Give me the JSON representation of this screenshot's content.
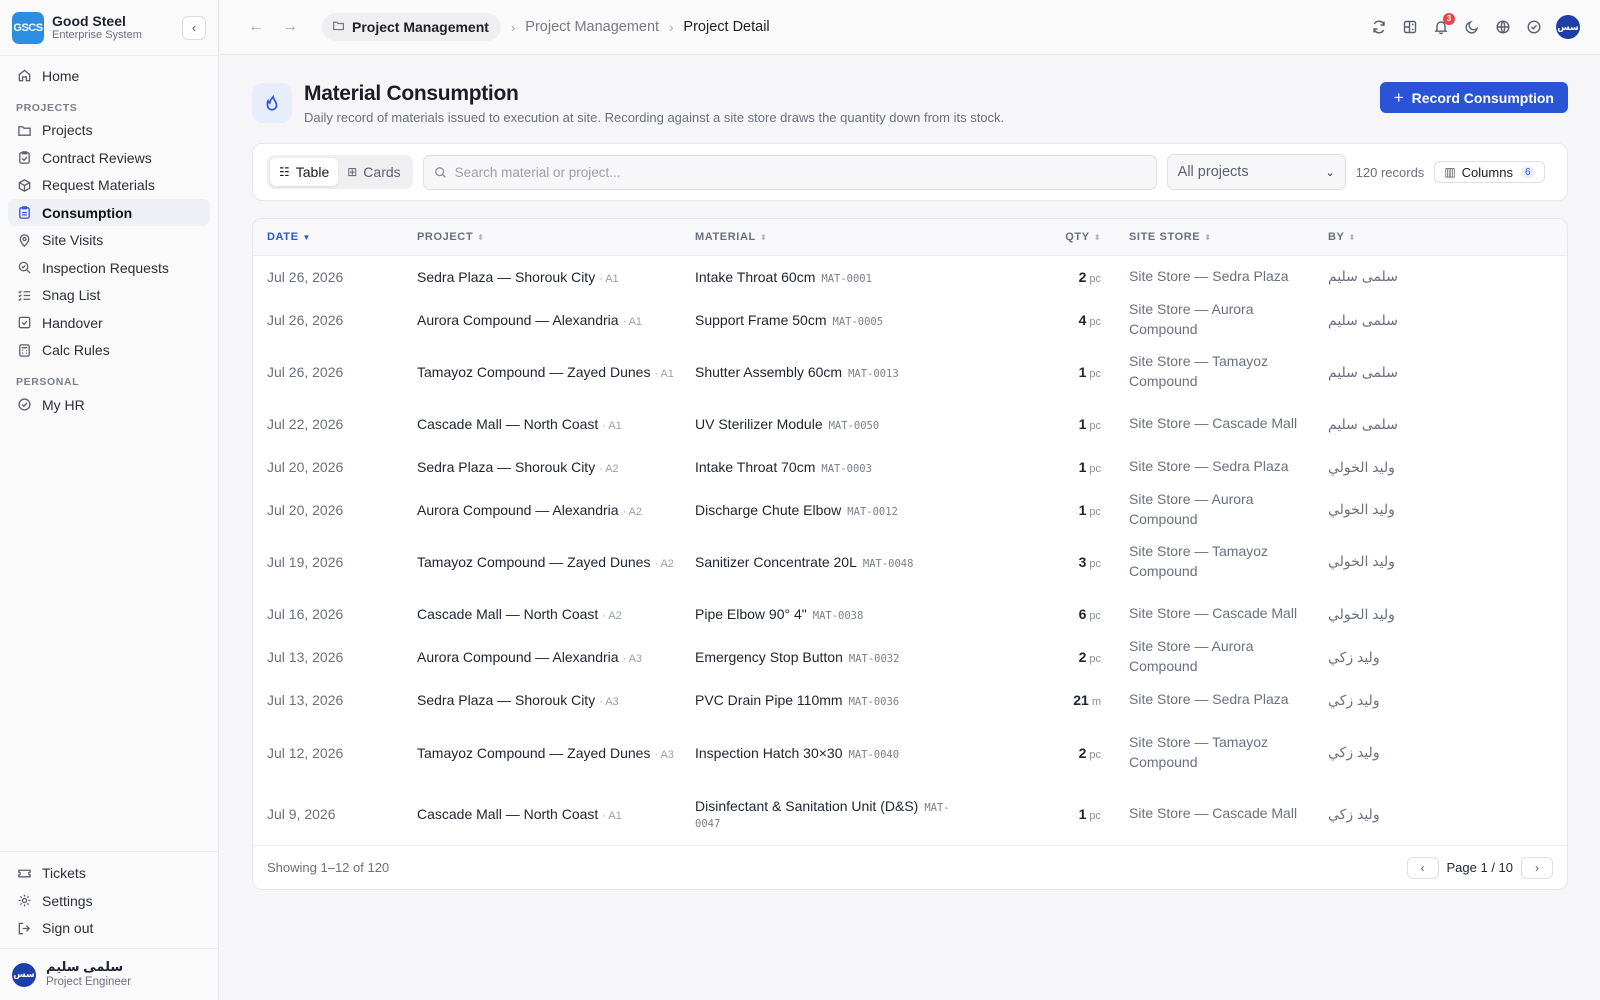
{
  "brand": {
    "logo": "GSCS",
    "name": "Good Steel",
    "subtitle": "Enterprise System"
  },
  "nav": {
    "home": "Home",
    "projects_section": "PROJECTS",
    "projects_items": [
      {
        "label": "Projects",
        "icon": "folder-icon"
      },
      {
        "label": "Contract Reviews",
        "icon": "clipboard-check-icon"
      },
      {
        "label": "Request Materials",
        "icon": "boxes-icon"
      },
      {
        "label": "Consumption",
        "icon": "clipboard-icon"
      },
      {
        "label": "Site Visits",
        "icon": "map-pin-icon"
      },
      {
        "label": "Inspection Requests",
        "icon": "search-check-icon"
      },
      {
        "label": "Snag List",
        "icon": "list-check-icon"
      },
      {
        "label": "Handover",
        "icon": "square-check-icon"
      },
      {
        "label": "Calc Rules",
        "icon": "calculator-icon"
      }
    ],
    "personal_section": "PERSONAL",
    "my_hr": "My HR",
    "bottom": {
      "tickets": "Tickets",
      "settings": "Settings",
      "sign_out": "Sign out"
    }
  },
  "user": {
    "name": "سلمى سليم",
    "role": "Project Engineer",
    "initials": "سس"
  },
  "topbar": {
    "chip": "Project Management",
    "crumb1": "Project Management",
    "crumb2": "Project Detail",
    "notifications_count": "3"
  },
  "page": {
    "title": "Material Consumption",
    "subtitle": "Daily record of materials issued to execution at site. Recording against a site store draws the quantity down from its stock.",
    "primary_action": "Record Consumption"
  },
  "toolbar": {
    "view_table": "Table",
    "view_cards": "Cards",
    "search_placeholder": "Search material or project...",
    "project_filter": "All projects",
    "records": "120 records",
    "columns_label": "Columns",
    "columns_count": "6"
  },
  "table": {
    "headers": {
      "date": "DATE",
      "project": "PROJECT",
      "material": "MATERIAL",
      "qty": "QTY",
      "site_store": "SITE STORE",
      "by": "BY"
    },
    "rows": [
      {
        "date": "Jul 26, 2026",
        "project": "Sedra Plaza — Shorouk City",
        "phase": "· A1",
        "material": "Intake Throat 60cm",
        "code": "MAT-0001",
        "qty": "2",
        "unit": "pc",
        "store": "Site Store — Sedra Plaza",
        "by": "سلمى سليم"
      },
      {
        "date": "Jul 26, 2026",
        "project": "Aurora Compound — Alexandria",
        "phase": "· A1",
        "material": "Support Frame 50cm",
        "code": "MAT-0005",
        "qty": "4",
        "unit": "pc",
        "store": "Site Store — Aurora Compound",
        "by": "سلمى سليم"
      },
      {
        "date": "Jul 26, 2026",
        "project": "Tamayoz Compound — Zayed Dunes",
        "phase": "· A1",
        "material": "Shutter Assembly 60cm",
        "code": "MAT-0013",
        "qty": "1",
        "unit": "pc",
        "store": "Site Store — Tamayoz Compound",
        "by": "سلمى سليم"
      },
      {
        "date": "Jul 22, 2026",
        "project": "Cascade Mall — North Coast",
        "phase": "· A1",
        "material": "UV Sterilizer Module",
        "code": "MAT-0050",
        "qty": "1",
        "unit": "pc",
        "store": "Site Store — Cascade Mall",
        "by": "سلمى سليم"
      },
      {
        "date": "Jul 20, 2026",
        "project": "Sedra Plaza — Shorouk City",
        "phase": "· A2",
        "material": "Intake Throat 70cm",
        "code": "MAT-0003",
        "qty": "1",
        "unit": "pc",
        "store": "Site Store — Sedra Plaza",
        "by": "وليد الخولي"
      },
      {
        "date": "Jul 20, 2026",
        "project": "Aurora Compound — Alexandria",
        "phase": "· A2",
        "material": "Discharge Chute Elbow",
        "code": "MAT-0012",
        "qty": "1",
        "unit": "pc",
        "store": "Site Store — Aurora Compound",
        "by": "وليد الخولي"
      },
      {
        "date": "Jul 19, 2026",
        "project": "Tamayoz Compound — Zayed Dunes",
        "phase": "· A2",
        "material": "Sanitizer Concentrate 20L",
        "code": "MAT-0048",
        "qty": "3",
        "unit": "pc",
        "store": "Site Store — Tamayoz Compound",
        "by": "وليد الخولي"
      },
      {
        "date": "Jul 16, 2026",
        "project": "Cascade Mall — North Coast",
        "phase": "· A2",
        "material": "Pipe Elbow 90° 4\"",
        "code": "MAT-0038",
        "qty": "6",
        "unit": "pc",
        "store": "Site Store — Cascade Mall",
        "by": "وليد الخولي"
      },
      {
        "date": "Jul 13, 2026",
        "project": "Aurora Compound — Alexandria",
        "phase": "· A3",
        "material": "Emergency Stop Button",
        "code": "MAT-0032",
        "qty": "2",
        "unit": "pc",
        "store": "Site Store — Aurora Compound",
        "by": "وليد زكي"
      },
      {
        "date": "Jul 13, 2026",
        "project": "Sedra Plaza — Shorouk City",
        "phase": "· A3",
        "material": "PVC Drain Pipe 110mm",
        "code": "MAT-0036",
        "qty": "21",
        "unit": "m",
        "store": "Site Store — Sedra Plaza",
        "by": "وليد زكي"
      },
      {
        "date": "Jul 12, 2026",
        "project": "Tamayoz Compound — Zayed Dunes",
        "phase": "· A3",
        "material": "Inspection Hatch 30×30",
        "code": "MAT-0040",
        "qty": "2",
        "unit": "pc",
        "store": "Site Store — Tamayoz Compound",
        "by": "وليد زكي"
      },
      {
        "date": "Jul 9, 2026",
        "project": "Cascade Mall — North Coast",
        "phase": "· A1",
        "material": "Disinfectant & Sanitation Unit (D&S)",
        "code": "MAT-0047",
        "qty": "1",
        "unit": "pc",
        "store": "Site Store — Cascade Mall",
        "by": "وليد زكي"
      }
    ]
  },
  "footer": {
    "showing": "Showing 1–12 of 120",
    "page": "Page 1 / 10"
  },
  "colors": {
    "accent": "#2a54d6",
    "brand": "#2a8fe0",
    "badge": "#e54545"
  }
}
